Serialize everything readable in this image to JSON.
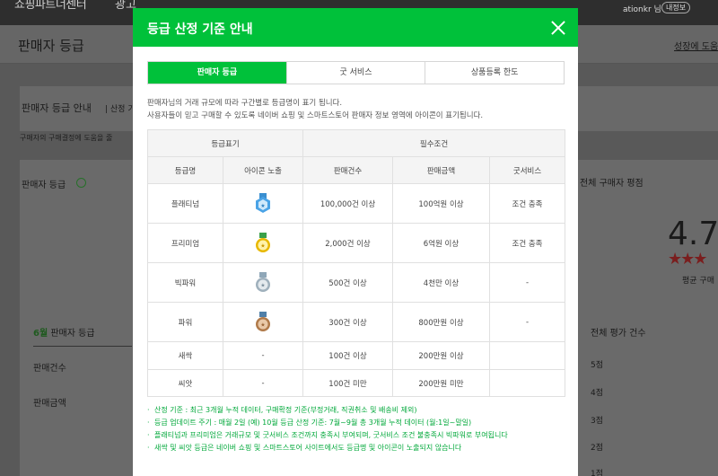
{
  "topbar": {
    "brand": "쇼핑파트너센터",
    "brand2": "광고",
    "user": "ationkr 님",
    "badge": "내정보"
  },
  "page": {
    "title": "판매자 등급",
    "help_link": "성장에 도움",
    "card1_title": "판매자 등급 안내",
    "card1_sub": "| 산정 기",
    "note": "구매자의 구매결정에 도움을 줄",
    "grade_label": "판매자 등급",
    "rating_label": "전체 구매자 평점",
    "score": "4.7",
    "stars": "★★★",
    "avg_label": "평균 구매",
    "month_highlight": "6월",
    "month_label": " 판매자 등급",
    "row1": "판매건수",
    "row2": "판매금액",
    "total_label": "전체 평가 건수",
    "points": [
      "5점",
      "4점",
      "3점",
      "2점",
      "1점"
    ]
  },
  "modal": {
    "title": "등급 산정 기준 안내",
    "tabs": [
      {
        "label": "판매자 등급",
        "active": true
      },
      {
        "label": "굿 서비스",
        "active": false
      },
      {
        "label": "상품등록 한도",
        "active": false
      }
    ],
    "intro_1": "판매자님의 거래 규모에 따라 구간별로 등급명이 표기 됩니다.",
    "intro_2": "사용자들이 믿고 구매할 수 있도록 네이버 쇼핑 및 스마트스토어 판매자 정보 영역에 아이콘이 표기됩니다.",
    "table": {
      "group_grade": "등급표기",
      "group_required": "필수조건",
      "columns": [
        "등급명",
        "아이콘 노출",
        "판매건수",
        "판매금액",
        "굿서비스"
      ],
      "rows": [
        {
          "name": "플래티넘",
          "icon": "platinum-medal-icon",
          "count": "100,000건 이상",
          "amount": "100억원 이상",
          "service": "조건 충족"
        },
        {
          "name": "프리미엄",
          "icon": "premium-medal-icon",
          "count": "2,000건 이상",
          "amount": "6억원 이상",
          "service": "조건 충족"
        },
        {
          "name": "빅파워",
          "icon": "bigpower-medal-icon",
          "count": "500건 이상",
          "amount": "4천만 이상",
          "service": "-"
        },
        {
          "name": "파워",
          "icon": "power-medal-icon",
          "count": "300건 이상",
          "amount": "800만원 이상",
          "service": "-"
        },
        {
          "name": "새싹",
          "icon_text": "-",
          "count": "100건 이상",
          "amount": "200만원 이상",
          "service": ""
        },
        {
          "name": "씨앗",
          "icon_text": "-",
          "count": "100건 미만",
          "amount": "200만원 미만",
          "service": ""
        }
      ]
    },
    "notes": [
      "산정 기준 : 최근 3개월 누적 데이터, 구매확정 기준(부정거래, 직권취소 및 배송비 제외)",
      "등급 업데이트 주기 : 매월 2일 (예) 10월 등급 산정 기준: 7월~9월 총 3개월 누적 데이터 (월:1일~말일)",
      "플래티넘과 프리미엄은 거래규모 및 굿서비스 조건까지 충족시 부여되며, 굿서비스 조건 불충족시 빅파워로 부여됩니다",
      "새싹 및 씨앗 등급은 네이버 쇼핑 및 스마트스토어 사이트에서도 등급명 및 아이콘이 노출되지 않습니다"
    ]
  },
  "colors": {
    "accent": "#00c13a",
    "note_text": "#00a83a"
  }
}
